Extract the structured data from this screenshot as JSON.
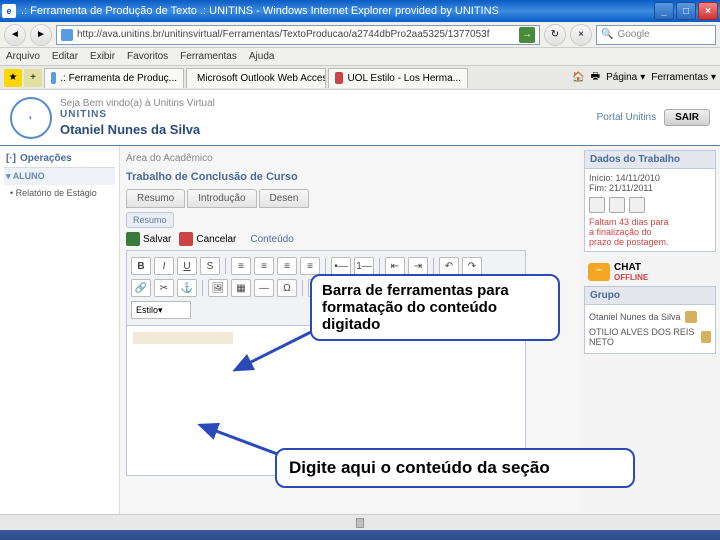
{
  "window": {
    "title": ".: Ferramenta de Produção de Texto .: UNITINS - Windows Internet Explorer provided by UNITINS",
    "url": "http://ava.unitins.br/unitinsvirtual/Ferramentas/TextoProducao/a2744dbPro2aa5325/1377053f",
    "search_placeholder": "Google"
  },
  "menus": [
    "Arquivo",
    "Editar",
    "Exibir",
    "Favoritos",
    "Ferramentas",
    "Ajuda"
  ],
  "tabs": [
    {
      "label": ".: Ferramenta de Produç..."
    },
    {
      "label": "Microsoft Outlook Web Access"
    },
    {
      "label": "UOL Estilo - Los Herma..."
    }
  ],
  "toolbar_links": {
    "home": "",
    "print": "",
    "page": "Página",
    "tools": "Ferramentas"
  },
  "portal": {
    "brand": "UNITINS",
    "welcome": "Seja Bem vindo(a) à Unitins Virtual",
    "user": "Otaniel Nunes da Silva",
    "portal_link": "Portal Unitins",
    "exit": "SAIR"
  },
  "sidebar": {
    "section1": "Operações",
    "section2": "ALUNO",
    "items": [
      "Relatório de Estágio"
    ]
  },
  "main": {
    "breadcrumb": "Área do Acadêmico",
    "title": "Trabalho de Conclusão de Curso",
    "tabs": [
      "Resumo",
      "Introdução",
      "Desen"
    ],
    "sublabel": "Resumo",
    "save": "Salvar",
    "cancel": "Cancelar",
    "content_label": "Conteúdo",
    "style_sel": "Estilo"
  },
  "right": {
    "box1_title": "Dados do Trabalho",
    "box1_l1": "Início: 14/11/2010",
    "box1_l2": "Fim: 21/11/2011",
    "box1_red1": "Faltam 43 dias para",
    "box1_red2": "a finalização do",
    "box1_red3": "prazo de postagem.",
    "chat": "CHAT",
    "chat_status": "OFFLINE",
    "box2_title": "Grupo",
    "grupo": [
      "Otaniel Nunes da Silva",
      "OTILIO ALVES DOS REIS NETO"
    ]
  },
  "callouts": {
    "c1": "Barra de ferramentas para formatação do conteúdo digitado",
    "c2": "Digite aqui o conteúdo da seção"
  }
}
